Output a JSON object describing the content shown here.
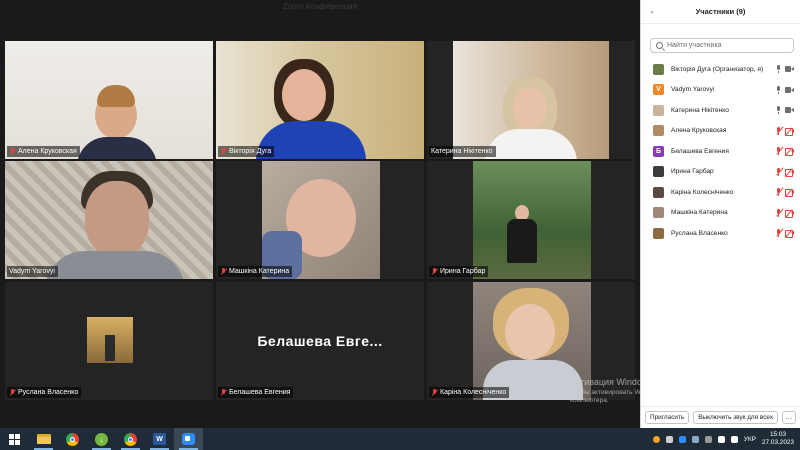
{
  "window": {
    "title": "Zoom Конференция"
  },
  "gallery": {
    "tiles": [
      {
        "name": "Алена Круковская",
        "muted": true,
        "bg": "#e8e4de"
      },
      {
        "name": "Вікторія Дуга",
        "muted": true,
        "bg": "#d7c9a9"
      },
      {
        "name": "Катерина Нікітенко",
        "muted": false,
        "bg": "#d9cfc3"
      },
      {
        "name": "Vadym Yarovyi",
        "muted": false,
        "bg": "#b9b4a8",
        "active": true
      },
      {
        "name": "Машкіна Катерина",
        "muted": true,
        "bg": "#a89c8f"
      },
      {
        "name": "Ирина Гарбар",
        "muted": true,
        "bg": "#4f6f45"
      },
      {
        "name": "Руслана Власенко",
        "muted": true,
        "bg": "#242424"
      },
      {
        "name": "Белашева Евгения",
        "muted": true,
        "bg": "#242424",
        "display": "Белашева Евге..."
      },
      {
        "name": "Каріна Колесніченко",
        "muted": true,
        "bg": "#7a6f68"
      }
    ]
  },
  "panel": {
    "title": "Участники (9)",
    "search_placeholder": "Найти участника",
    "participants": [
      {
        "name": "Вікторія Дуга (Организатор, я)",
        "avatar_color": "#6b7b4a",
        "avatar_letter": "",
        "mic": "on",
        "cam": "on"
      },
      {
        "name": "Vadym Yarovyi",
        "avatar_color": "#f0882b",
        "avatar_letter": "V",
        "mic": "on",
        "cam": "on"
      },
      {
        "name": "Катерина Нікітенко",
        "avatar_color": "#c8b49a",
        "avatar_letter": "",
        "mic": "on",
        "cam": "on"
      },
      {
        "name": "Алена Круковская",
        "avatar_color": "#b08a62",
        "avatar_letter": "",
        "mic": "off",
        "cam": "off"
      },
      {
        "name": "Белашева Евгения",
        "avatar_color": "#8a3ab9",
        "avatar_letter": "Б",
        "mic": "off",
        "cam": "off"
      },
      {
        "name": "Ирина Гарбар",
        "avatar_color": "#3b3b3b",
        "avatar_letter": "",
        "mic": "off",
        "cam": "off"
      },
      {
        "name": "Каріна Колесніченко",
        "avatar_color": "#5a4a44",
        "avatar_letter": "",
        "mic": "off",
        "cam": "off"
      },
      {
        "name": "Машкіна Катерина",
        "avatar_color": "#a0877a",
        "avatar_letter": "",
        "mic": "off",
        "cam": "off"
      },
      {
        "name": "Руслана Власенко",
        "avatar_color": "#8c6a44",
        "avatar_letter": "",
        "mic": "off",
        "cam": "off"
      }
    ],
    "footer": {
      "invite_label": "Пригласить",
      "mute_all_label": "Выключить звук для всех",
      "more_label": "..."
    }
  },
  "watermark": {
    "title": "Активация Windows",
    "subtitle": "Чтобы активировать Windows, перейдите к параметрам компьютера."
  },
  "taskbar": {
    "apps": [
      "start-button",
      "file-explorer-icon",
      "chrome-icon",
      "torrent-icon",
      "chrome-icon",
      "word-icon",
      "zoom-icon"
    ],
    "language": "УКР",
    "time": "15:03",
    "date": "27.03.2023"
  },
  "colors": {
    "accent_active": "#c8d13c",
    "muted_red": "#e0453c",
    "taskbar": "#1f2b36"
  }
}
